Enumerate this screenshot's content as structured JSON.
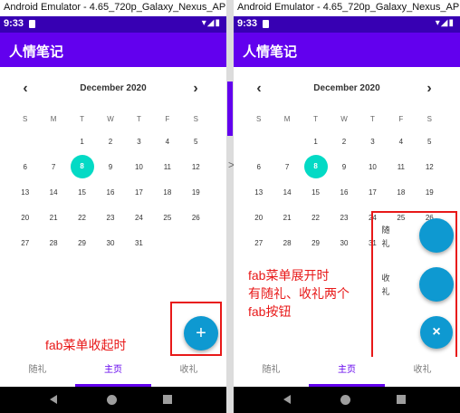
{
  "left": {
    "window_title": "Android Emulator - 4.65_720p_Galaxy_Nexus_API_29:5554",
    "status_time": "9:33",
    "status_icons": "▾◢▮",
    "app_title": "人情笔记",
    "calendar": {
      "prev_icon": "‹",
      "next_icon": "›",
      "month": "December 2020",
      "weekdays": [
        "S",
        "M",
        "T",
        "W",
        "T",
        "F",
        "S"
      ],
      "weeks": [
        [
          "",
          "",
          "1",
          "2",
          "3",
          "4",
          "5"
        ],
        [
          "6",
          "7",
          "8",
          "9",
          "10",
          "11",
          "12"
        ],
        [
          "13",
          "14",
          "15",
          "16",
          "17",
          "18",
          "19"
        ],
        [
          "20",
          "21",
          "22",
          "23",
          "24",
          "25",
          "26"
        ],
        [
          "27",
          "28",
          "29",
          "30",
          "31",
          "",
          ""
        ]
      ],
      "selected_day": "8"
    },
    "fab_label": "+",
    "annotation": "fab菜单收起时",
    "bottom_nav": [
      "随礼",
      "主页",
      "收礼"
    ],
    "bottom_nav_active": 1
  },
  "right": {
    "window_title": "Android Emulator - 4.65_720p_Galaxy_Nexus_API_29:5554",
    "status_time": "9:33",
    "status_icons": "▾◢▮",
    "app_title": "人情笔记",
    "calendar": {
      "prev_icon": "‹",
      "next_icon": "›",
      "month": "December 2020",
      "weekdays": [
        "S",
        "M",
        "T",
        "W",
        "T",
        "F",
        "S"
      ],
      "weeks": [
        [
          "",
          "",
          "1",
          "2",
          "3",
          "4",
          "5"
        ],
        [
          "6",
          "7",
          "8",
          "9",
          "10",
          "11",
          "12"
        ],
        [
          "13",
          "14",
          "15",
          "16",
          "17",
          "18",
          "19"
        ],
        [
          "20",
          "21",
          "22",
          "23",
          "24",
          "25",
          "26"
        ],
        [
          "27",
          "28",
          "29",
          "30",
          "31",
          "",
          ""
        ]
      ],
      "selected_day": "8"
    },
    "fab_menu": {
      "item1_label_top": "随",
      "item1_label_bottom": "礼",
      "item2_label_top": "收",
      "item2_label_bottom": "礼",
      "close_label": "×"
    },
    "annotation_line1": "fab菜单展开时",
    "annotation_line2": "有随礼、收礼两个",
    "annotation_line3": "fab按钮",
    "bottom_nav": [
      "随礼",
      "主页",
      "收礼"
    ],
    "bottom_nav_active": 1
  },
  "divider_glyph": ">",
  "colors": {
    "primary": "#6200ee",
    "status": "#3700b3",
    "selected_day": "#03dac5",
    "fab": "#0e99d1",
    "annotation": "#e81919"
  }
}
